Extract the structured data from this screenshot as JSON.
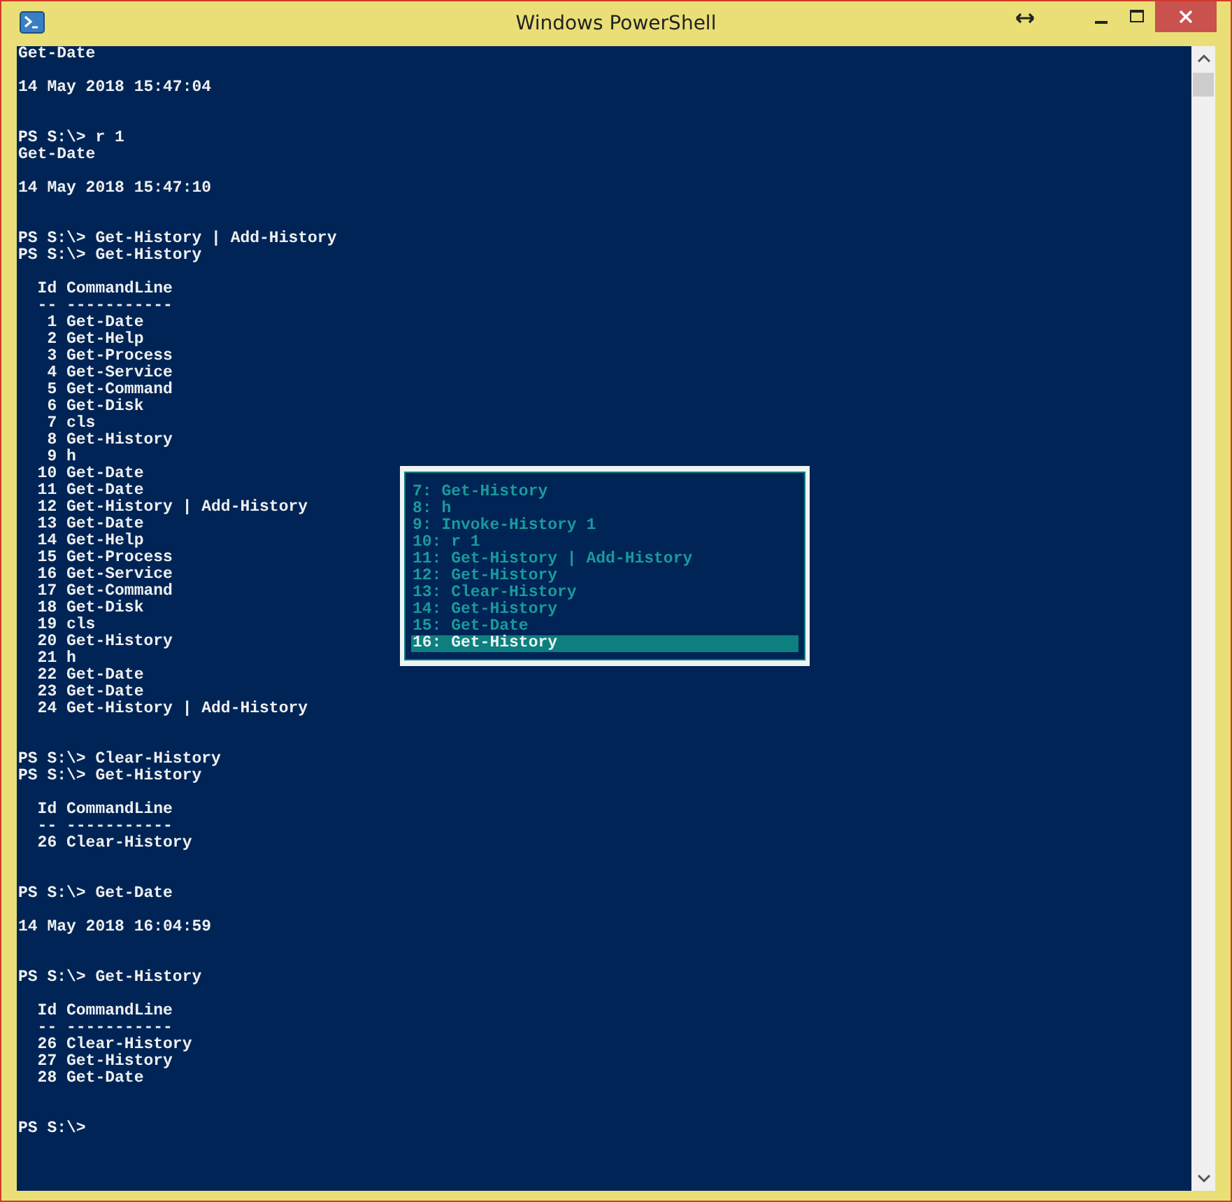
{
  "window": {
    "title": "Windows PowerShell"
  },
  "console": {
    "lines": [
      {
        "kind": "text",
        "text": "Get-Date"
      },
      {
        "kind": "blank"
      },
      {
        "kind": "text",
        "text": "14 May 2018 15:47:04"
      },
      {
        "kind": "blank"
      },
      {
        "kind": "blank"
      },
      {
        "kind": "text",
        "text": "PS S:\\> r 1"
      },
      {
        "kind": "text",
        "text": "Get-Date"
      },
      {
        "kind": "blank"
      },
      {
        "kind": "text",
        "text": "14 May 2018 15:47:10"
      },
      {
        "kind": "blank"
      },
      {
        "kind": "blank"
      },
      {
        "kind": "text",
        "text": "PS S:\\> Get-History | Add-History"
      },
      {
        "kind": "text",
        "text": "PS S:\\> Get-History"
      },
      {
        "kind": "blank"
      },
      {
        "kind": "text",
        "text": "  Id CommandLine"
      },
      {
        "kind": "text",
        "text": "  -- -----------"
      },
      {
        "kind": "text",
        "text": "   1 Get-Date"
      },
      {
        "kind": "text",
        "text": "   2 Get-Help"
      },
      {
        "kind": "text",
        "text": "   3 Get-Process"
      },
      {
        "kind": "text",
        "text": "   4 Get-Service"
      },
      {
        "kind": "text",
        "text": "   5 Get-Command"
      },
      {
        "kind": "text",
        "text": "   6 Get-Disk"
      },
      {
        "kind": "text",
        "text": "   7 cls"
      },
      {
        "kind": "text",
        "text": "   8 Get-History"
      },
      {
        "kind": "text",
        "text": "   9 h"
      },
      {
        "kind": "text",
        "text": "  10 Get-Date"
      },
      {
        "kind": "text",
        "text": "  11 Get-Date"
      },
      {
        "kind": "text",
        "text": "  12 Get-History | Add-History"
      },
      {
        "kind": "text",
        "text": "  13 Get-Date"
      },
      {
        "kind": "text",
        "text": "  14 Get-Help"
      },
      {
        "kind": "text",
        "text": "  15 Get-Process"
      },
      {
        "kind": "text",
        "text": "  16 Get-Service"
      },
      {
        "kind": "text",
        "text": "  17 Get-Command"
      },
      {
        "kind": "text",
        "text": "  18 Get-Disk"
      },
      {
        "kind": "text",
        "text": "  19 cls"
      },
      {
        "kind": "text",
        "text": "  20 Get-History"
      },
      {
        "kind": "text",
        "text": "  21 h"
      },
      {
        "kind": "text",
        "text": "  22 Get-Date"
      },
      {
        "kind": "text",
        "text": "  23 Get-Date"
      },
      {
        "kind": "text",
        "text": "  24 Get-History | Add-History"
      },
      {
        "kind": "blank"
      },
      {
        "kind": "blank"
      },
      {
        "kind": "text",
        "text": "PS S:\\> Clear-History"
      },
      {
        "kind": "text",
        "text": "PS S:\\> Get-History"
      },
      {
        "kind": "blank"
      },
      {
        "kind": "text",
        "text": "  Id CommandLine"
      },
      {
        "kind": "text",
        "text": "  -- -----------"
      },
      {
        "kind": "text",
        "text": "  26 Clear-History"
      },
      {
        "kind": "blank"
      },
      {
        "kind": "blank"
      },
      {
        "kind": "text",
        "text": "PS S:\\> Get-Date"
      },
      {
        "kind": "blank"
      },
      {
        "kind": "text",
        "text": "14 May 2018 16:04:59"
      },
      {
        "kind": "blank"
      },
      {
        "kind": "blank"
      },
      {
        "kind": "text",
        "text": "PS S:\\> Get-History"
      },
      {
        "kind": "blank"
      },
      {
        "kind": "text",
        "text": "  Id CommandLine"
      },
      {
        "kind": "text",
        "text": "  -- -----------"
      },
      {
        "kind": "text",
        "text": "  26 Clear-History"
      },
      {
        "kind": "text",
        "text": "  27 Get-History"
      },
      {
        "kind": "text",
        "text": "  28 Get-Date"
      },
      {
        "kind": "blank"
      },
      {
        "kind": "blank"
      },
      {
        "kind": "text",
        "text": "PS S:\\>"
      }
    ]
  },
  "history_popup": {
    "items": [
      {
        "text": "7: Get-History",
        "selected": false
      },
      {
        "text": "8: h",
        "selected": false
      },
      {
        "text": "9: Invoke-History 1",
        "selected": false
      },
      {
        "text": "10: r 1",
        "selected": false
      },
      {
        "text": "11: Get-History | Add-History",
        "selected": false
      },
      {
        "text": "12: Get-History",
        "selected": false
      },
      {
        "text": "13: Clear-History",
        "selected": false
      },
      {
        "text": "14: Get-History",
        "selected": false
      },
      {
        "text": "15: Get-Date",
        "selected": false
      },
      {
        "text": "16: Get-History",
        "selected": true
      }
    ]
  }
}
